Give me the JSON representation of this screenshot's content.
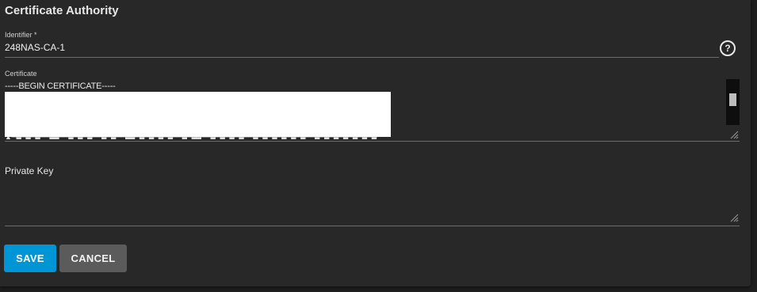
{
  "form": {
    "title": "Certificate Authority",
    "identifier": {
      "label": "Identifier *",
      "value": "248NAS-CA-1"
    },
    "help_icon": "question-circle-icon",
    "certificate": {
      "label": "Certificate",
      "first_line": "-----BEGIN CERTIFICATE-----"
    },
    "private_key": {
      "label": "Private Key",
      "value": ""
    }
  },
  "actions": {
    "save_label": "SAVE",
    "cancel_label": "CANCEL"
  },
  "colors": {
    "background": "#282828",
    "primary": "#0095d5",
    "secondary": "#5b5b5b",
    "text": "#e6e6e6"
  }
}
